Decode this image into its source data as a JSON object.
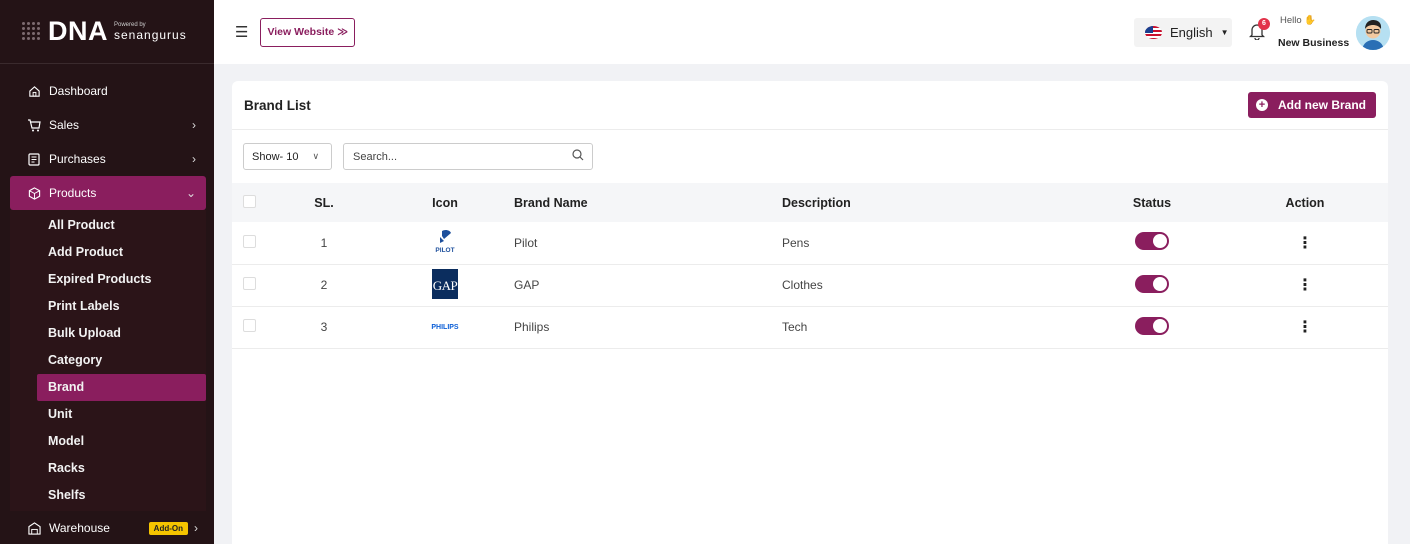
{
  "logo": {
    "text": "DNA",
    "powered": "Powered by",
    "brand": "senangurus"
  },
  "nav": {
    "dashboard": "Dashboard",
    "sales": "Sales",
    "purchases": "Purchases",
    "products": "Products",
    "products_sub": [
      "All Product",
      "Add Product",
      "Expired Products",
      "Print Labels",
      "Bulk Upload",
      "Category",
      "Brand",
      "Unit",
      "Model",
      "Racks",
      "Shelfs"
    ],
    "warehouse": "Warehouse",
    "addon": "Add-On"
  },
  "header": {
    "view_website": "View Website ≫",
    "language": "English",
    "notification_count": "6",
    "greeting": "Hello",
    "user_name": "New Business"
  },
  "page": {
    "title": "Brand List",
    "add_button": "Add new Brand",
    "show_select": "Show- 10",
    "search_placeholder": "Search..."
  },
  "table": {
    "headers": [
      "SL.",
      "Icon",
      "Brand Name",
      "Description",
      "Status",
      "Action"
    ],
    "rows": [
      {
        "sl": "1",
        "icon": "pilot-logo",
        "icon_text": "PILOT",
        "name": "Pilot",
        "description": "Pens",
        "status": true
      },
      {
        "sl": "2",
        "icon": "gap-logo",
        "icon_text": "GAP",
        "name": "GAP",
        "description": "Clothes",
        "status": true
      },
      {
        "sl": "3",
        "icon": "philips-logo",
        "icon_text": "PHILIPS",
        "name": "Philips",
        "description": "Tech",
        "status": true
      }
    ]
  },
  "colors": {
    "primary": "#8a1e5e",
    "sidebar": "#241316",
    "badge": "#f5c400"
  }
}
